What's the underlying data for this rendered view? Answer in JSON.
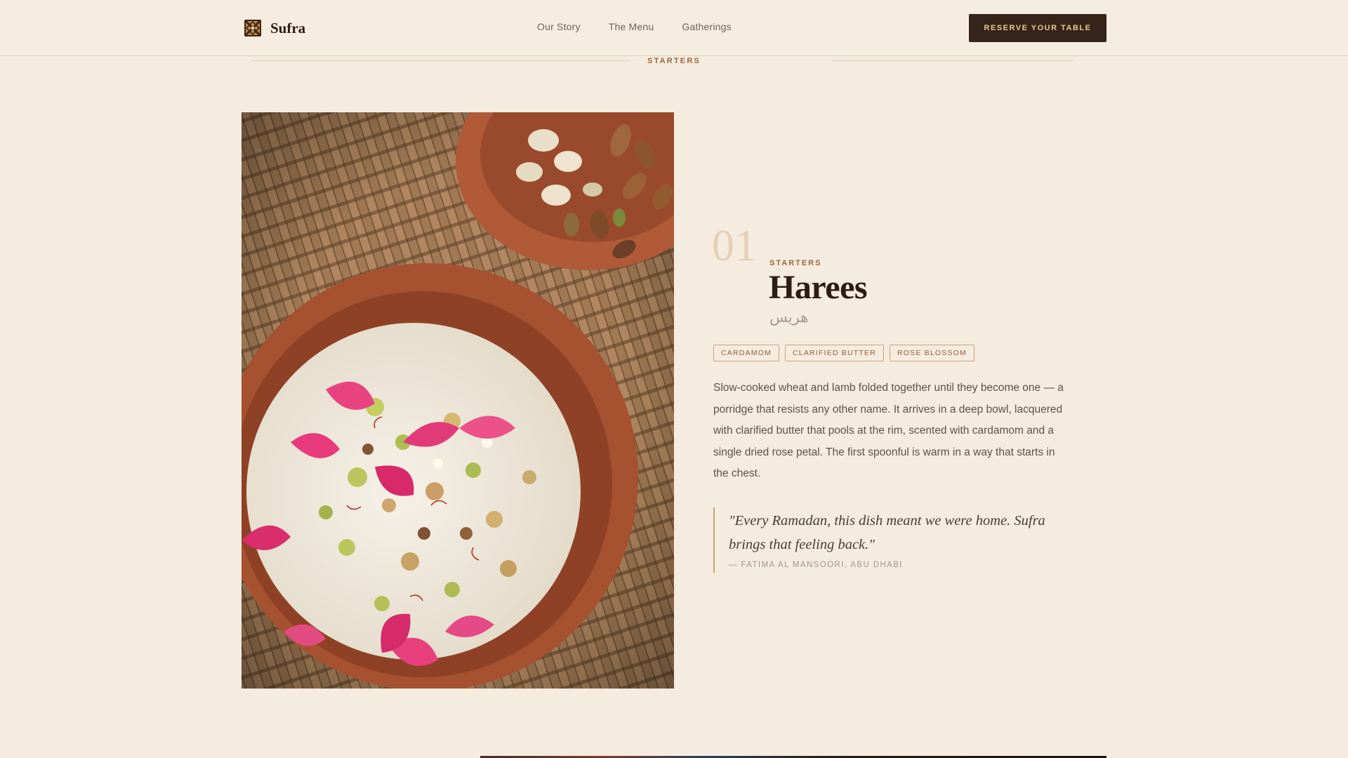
{
  "header": {
    "brand": {
      "name": "Sufra",
      "icon": "sufra-pattern-logo"
    },
    "nav": [
      {
        "label": "Our Story"
      },
      {
        "label": "The Menu"
      },
      {
        "label": "Gatherings"
      }
    ],
    "cta_label": "RESERVE YOUR TABLE"
  },
  "section": {
    "label": "STARTERS"
  },
  "dish": {
    "number": "01",
    "category": "STARTERS",
    "name": "Harees",
    "name_arabic": "هريس",
    "tags": [
      "CARDAMOM",
      "CLARIFIED BUTTER",
      "ROSE BLOSSOM"
    ],
    "description": "Slow-cooked wheat and lamb folded together until they become one — a porridge that resists any other name. It arrives in a deep bowl, lacquered with clarified butter that pools at the rim, scented with cardamom and a single dried rose petal. The first spoonful is warm in a way that starts in the chest.",
    "quote": {
      "text": "\"Every Ramadan, this dish meant we were home. Sufra brings that feeling back.\"",
      "author": "— FATIMA AL MANSOORI, ABU DHABI"
    }
  },
  "colors": {
    "background": "#f5ece0",
    "accent": "#a0643c",
    "button": "#36231a",
    "button_text": "#e8c98c"
  }
}
